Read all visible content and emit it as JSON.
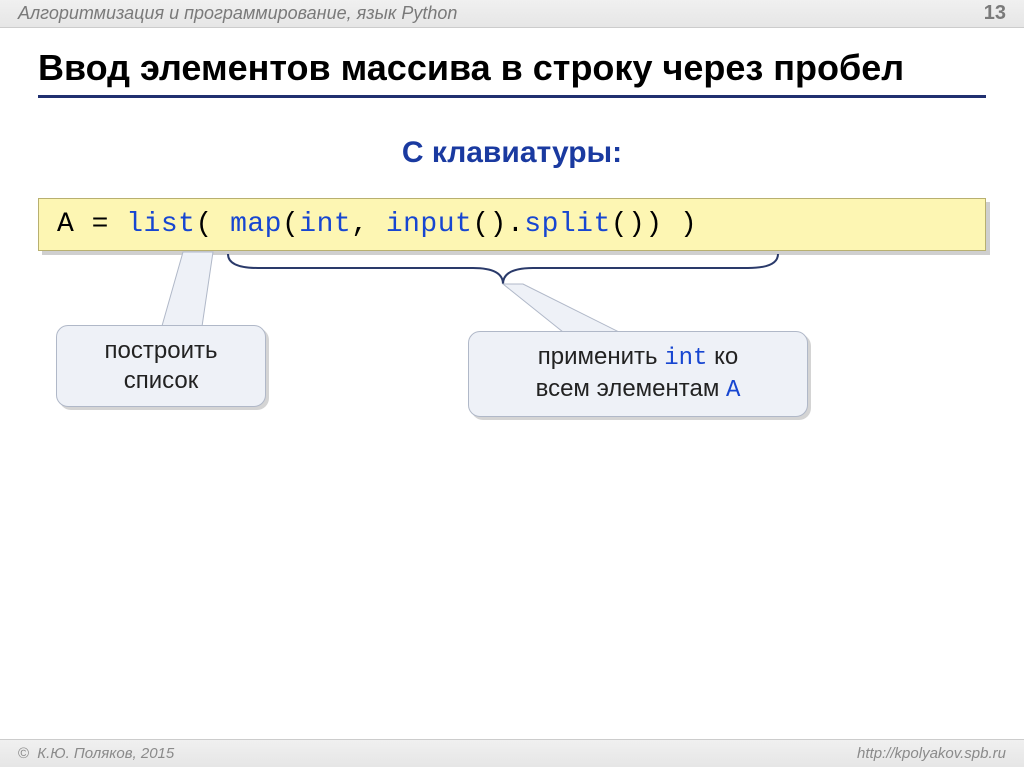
{
  "header": {
    "breadcrumb": "Алгоритмизация и программирование, язык Python",
    "page_number": "13"
  },
  "title": "Ввод элементов массива в строку через пробел",
  "subtitle": "С  клавиатуры:",
  "code": {
    "tokens": [
      {
        "cls": "kw-var",
        "t": "A"
      },
      {
        "cls": "kw-punct",
        "t": " = "
      },
      {
        "cls": "kw-func",
        "t": "list"
      },
      {
        "cls": "kw-punct",
        "t": "( "
      },
      {
        "cls": "kw-func",
        "t": "map"
      },
      {
        "cls": "kw-punct",
        "t": "("
      },
      {
        "cls": "kw-func",
        "t": "int"
      },
      {
        "cls": "kw-punct",
        "t": ", "
      },
      {
        "cls": "kw-func",
        "t": "input"
      },
      {
        "cls": "kw-punct",
        "t": "()."
      },
      {
        "cls": "kw-func",
        "t": "split"
      },
      {
        "cls": "kw-punct",
        "t": "()) )"
      }
    ]
  },
  "callouts": {
    "left": {
      "line1": "построить",
      "line2": "список"
    },
    "right": {
      "pre": "применить ",
      "mono": "int",
      "post1": " ко",
      "post2": "всем элементам ",
      "mono2": "A"
    }
  },
  "footer": {
    "copyright": "К.Ю. Поляков, 2015",
    "url": "http://kpolyakov.spb.ru"
  }
}
